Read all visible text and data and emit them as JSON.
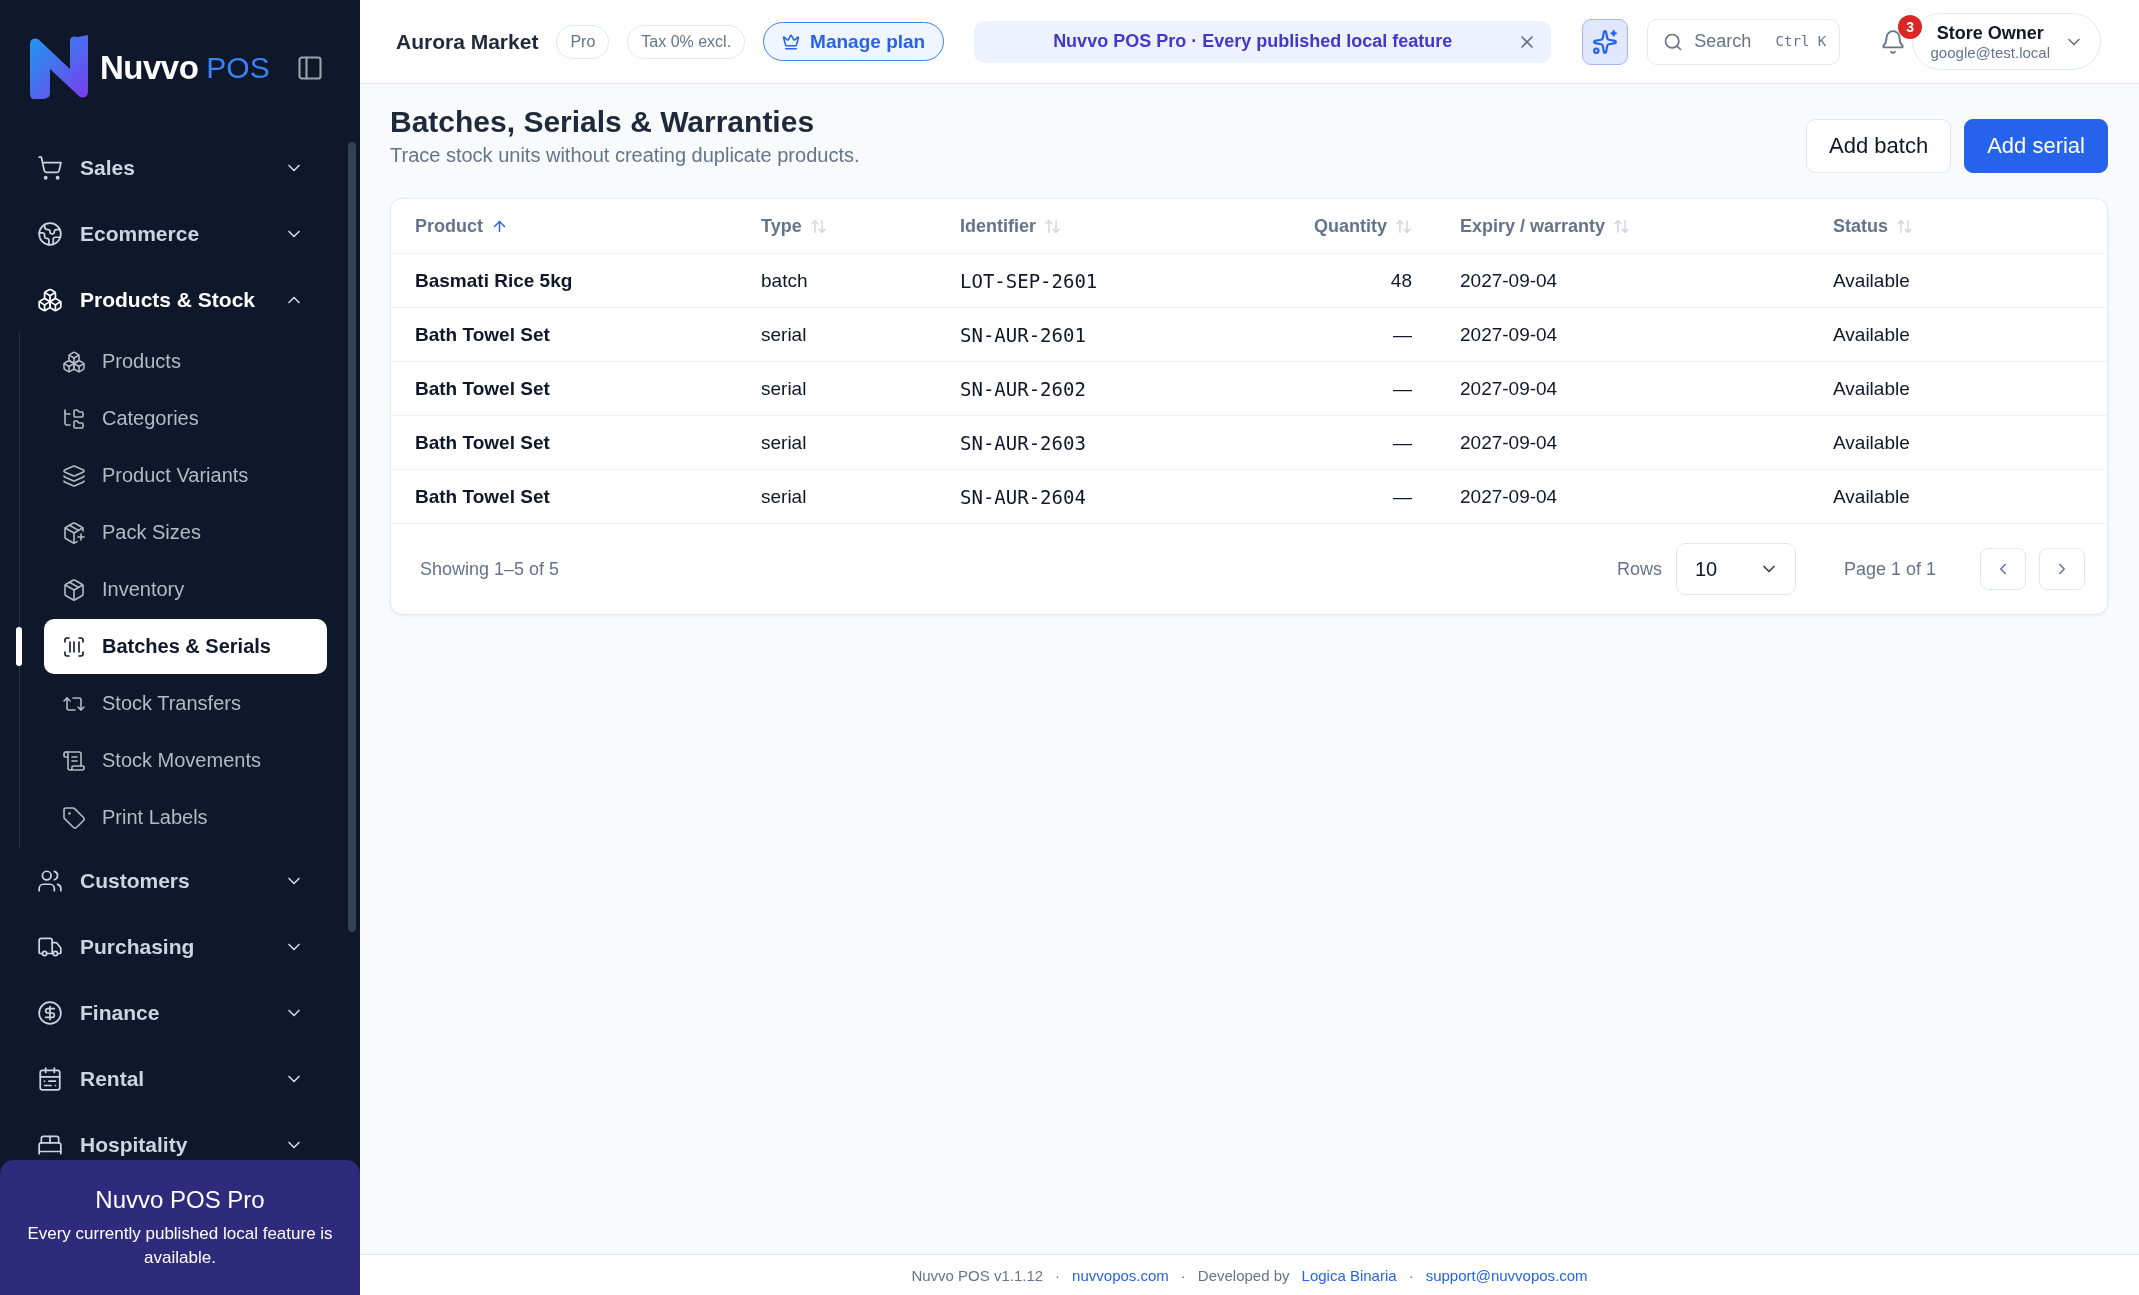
{
  "sidebar": {
    "logo": {
      "word": "Nuvvo",
      "suffix": "POS"
    },
    "groups": [
      {
        "label": "Sales",
        "expanded": false
      },
      {
        "label": "Ecommerce",
        "expanded": false
      },
      {
        "label": "Products & Stock",
        "expanded": true,
        "children": [
          {
            "label": "Products",
            "selected": false
          },
          {
            "label": "Categories",
            "selected": false
          },
          {
            "label": "Product Variants",
            "selected": false
          },
          {
            "label": "Pack Sizes",
            "selected": false
          },
          {
            "label": "Inventory",
            "selected": false
          },
          {
            "label": "Batches & Serials",
            "selected": true
          },
          {
            "label": "Stock Transfers",
            "selected": false
          },
          {
            "label": "Stock Movements",
            "selected": false
          },
          {
            "label": "Print Labels",
            "selected": false
          }
        ]
      },
      {
        "label": "Customers",
        "expanded": false
      },
      {
        "label": "Purchasing",
        "expanded": false
      },
      {
        "label": "Finance",
        "expanded": false
      },
      {
        "label": "Rental",
        "expanded": false
      },
      {
        "label": "Hospitality",
        "expanded": false
      }
    ],
    "promo": {
      "title": "Nuvvo POS Pro",
      "text": "Every currently published local feature is available."
    }
  },
  "header": {
    "store": "Aurora Market",
    "badges": [
      "Pro",
      "Tax 0% excl."
    ],
    "manage_plan": "Manage plan",
    "banner": {
      "text": "Nuvvo POS Pro · Every published local feature"
    },
    "search": {
      "placeholder": "Search",
      "shortcut": "Ctrl K"
    },
    "notifications": "3",
    "user": {
      "name": "Store Owner",
      "email": "google@test.local"
    }
  },
  "page": {
    "title": "Batches, Serials & Warranties",
    "subtitle": "Trace stock units without creating duplicate products.",
    "actions": [
      {
        "label": "Add batch",
        "kind": "secondary"
      },
      {
        "label": "Add serial",
        "kind": "primary"
      }
    ]
  },
  "table": {
    "columns": [
      {
        "label": "Product",
        "sorted": true
      },
      {
        "label": "Type",
        "sorted": false
      },
      {
        "label": "Identifier",
        "sorted": false
      },
      {
        "label": "Quantity",
        "sorted": false
      },
      {
        "label": "Expiry / warranty",
        "sorted": false
      },
      {
        "label": "Status",
        "sorted": false
      }
    ],
    "rows": [
      [
        "Basmati Rice 5kg",
        "batch",
        "LOT-SEP-2601",
        "48",
        "2027-09-04",
        "Available"
      ],
      [
        "Bath Towel Set",
        "serial",
        "SN-AUR-2601",
        "—",
        "2027-09-04",
        "Available"
      ],
      [
        "Bath Towel Set",
        "serial",
        "SN-AUR-2602",
        "—",
        "2027-09-04",
        "Available"
      ],
      [
        "Bath Towel Set",
        "serial",
        "SN-AUR-2603",
        "—",
        "2027-09-04",
        "Available"
      ],
      [
        "Bath Towel Set",
        "serial",
        "SN-AUR-2604",
        "—",
        "2027-09-04",
        "Available"
      ]
    ],
    "summary": "Showing 1–5 of 5",
    "rows_label": "Rows",
    "rows_value": "10",
    "page_label": "Page 1 of 1"
  },
  "footer": [
    {
      "text": "Nuvvo POS v1.1.12",
      "link": false
    },
    {
      "text": "·",
      "link": false
    },
    {
      "text": "nuvvopos.com",
      "link": true
    },
    {
      "text": "·",
      "link": false
    },
    {
      "text": "Developed by",
      "link": false
    },
    {
      "text": "Logica Binaria",
      "link": true
    },
    {
      "text": "·",
      "link": false
    },
    {
      "text": "support@nuvvopos.com",
      "link": true
    }
  ]
}
